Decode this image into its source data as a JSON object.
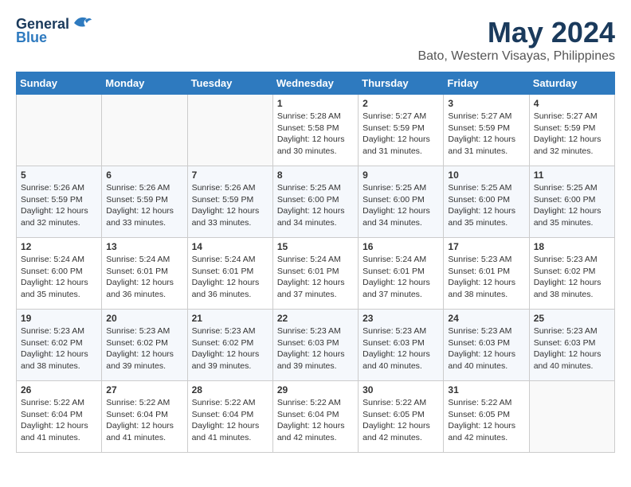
{
  "header": {
    "logo_general": "General",
    "logo_blue": "Blue",
    "month": "May 2024",
    "location": "Bato, Western Visayas, Philippines"
  },
  "days_of_week": [
    "Sunday",
    "Monday",
    "Tuesday",
    "Wednesday",
    "Thursday",
    "Friday",
    "Saturday"
  ],
  "weeks": [
    [
      {
        "day": "",
        "info": ""
      },
      {
        "day": "",
        "info": ""
      },
      {
        "day": "",
        "info": ""
      },
      {
        "day": "1",
        "info": "Sunrise: 5:28 AM\nSunset: 5:58 PM\nDaylight: 12 hours\nand 30 minutes."
      },
      {
        "day": "2",
        "info": "Sunrise: 5:27 AM\nSunset: 5:59 PM\nDaylight: 12 hours\nand 31 minutes."
      },
      {
        "day": "3",
        "info": "Sunrise: 5:27 AM\nSunset: 5:59 PM\nDaylight: 12 hours\nand 31 minutes."
      },
      {
        "day": "4",
        "info": "Sunrise: 5:27 AM\nSunset: 5:59 PM\nDaylight: 12 hours\nand 32 minutes."
      }
    ],
    [
      {
        "day": "5",
        "info": "Sunrise: 5:26 AM\nSunset: 5:59 PM\nDaylight: 12 hours\nand 32 minutes."
      },
      {
        "day": "6",
        "info": "Sunrise: 5:26 AM\nSunset: 5:59 PM\nDaylight: 12 hours\nand 33 minutes."
      },
      {
        "day": "7",
        "info": "Sunrise: 5:26 AM\nSunset: 5:59 PM\nDaylight: 12 hours\nand 33 minutes."
      },
      {
        "day": "8",
        "info": "Sunrise: 5:25 AM\nSunset: 6:00 PM\nDaylight: 12 hours\nand 34 minutes."
      },
      {
        "day": "9",
        "info": "Sunrise: 5:25 AM\nSunset: 6:00 PM\nDaylight: 12 hours\nand 34 minutes."
      },
      {
        "day": "10",
        "info": "Sunrise: 5:25 AM\nSunset: 6:00 PM\nDaylight: 12 hours\nand 35 minutes."
      },
      {
        "day": "11",
        "info": "Sunrise: 5:25 AM\nSunset: 6:00 PM\nDaylight: 12 hours\nand 35 minutes."
      }
    ],
    [
      {
        "day": "12",
        "info": "Sunrise: 5:24 AM\nSunset: 6:00 PM\nDaylight: 12 hours\nand 35 minutes."
      },
      {
        "day": "13",
        "info": "Sunrise: 5:24 AM\nSunset: 6:01 PM\nDaylight: 12 hours\nand 36 minutes."
      },
      {
        "day": "14",
        "info": "Sunrise: 5:24 AM\nSunset: 6:01 PM\nDaylight: 12 hours\nand 36 minutes."
      },
      {
        "day": "15",
        "info": "Sunrise: 5:24 AM\nSunset: 6:01 PM\nDaylight: 12 hours\nand 37 minutes."
      },
      {
        "day": "16",
        "info": "Sunrise: 5:24 AM\nSunset: 6:01 PM\nDaylight: 12 hours\nand 37 minutes."
      },
      {
        "day": "17",
        "info": "Sunrise: 5:23 AM\nSunset: 6:01 PM\nDaylight: 12 hours\nand 38 minutes."
      },
      {
        "day": "18",
        "info": "Sunrise: 5:23 AM\nSunset: 6:02 PM\nDaylight: 12 hours\nand 38 minutes."
      }
    ],
    [
      {
        "day": "19",
        "info": "Sunrise: 5:23 AM\nSunset: 6:02 PM\nDaylight: 12 hours\nand 38 minutes."
      },
      {
        "day": "20",
        "info": "Sunrise: 5:23 AM\nSunset: 6:02 PM\nDaylight: 12 hours\nand 39 minutes."
      },
      {
        "day": "21",
        "info": "Sunrise: 5:23 AM\nSunset: 6:02 PM\nDaylight: 12 hours\nand 39 minutes."
      },
      {
        "day": "22",
        "info": "Sunrise: 5:23 AM\nSunset: 6:03 PM\nDaylight: 12 hours\nand 39 minutes."
      },
      {
        "day": "23",
        "info": "Sunrise: 5:23 AM\nSunset: 6:03 PM\nDaylight: 12 hours\nand 40 minutes."
      },
      {
        "day": "24",
        "info": "Sunrise: 5:23 AM\nSunset: 6:03 PM\nDaylight: 12 hours\nand 40 minutes."
      },
      {
        "day": "25",
        "info": "Sunrise: 5:23 AM\nSunset: 6:03 PM\nDaylight: 12 hours\nand 40 minutes."
      }
    ],
    [
      {
        "day": "26",
        "info": "Sunrise: 5:22 AM\nSunset: 6:04 PM\nDaylight: 12 hours\nand 41 minutes."
      },
      {
        "day": "27",
        "info": "Sunrise: 5:22 AM\nSunset: 6:04 PM\nDaylight: 12 hours\nand 41 minutes."
      },
      {
        "day": "28",
        "info": "Sunrise: 5:22 AM\nSunset: 6:04 PM\nDaylight: 12 hours\nand 41 minutes."
      },
      {
        "day": "29",
        "info": "Sunrise: 5:22 AM\nSunset: 6:04 PM\nDaylight: 12 hours\nand 42 minutes."
      },
      {
        "day": "30",
        "info": "Sunrise: 5:22 AM\nSunset: 6:05 PM\nDaylight: 12 hours\nand 42 minutes."
      },
      {
        "day": "31",
        "info": "Sunrise: 5:22 AM\nSunset: 6:05 PM\nDaylight: 12 hours\nand 42 minutes."
      },
      {
        "day": "",
        "info": ""
      }
    ]
  ]
}
